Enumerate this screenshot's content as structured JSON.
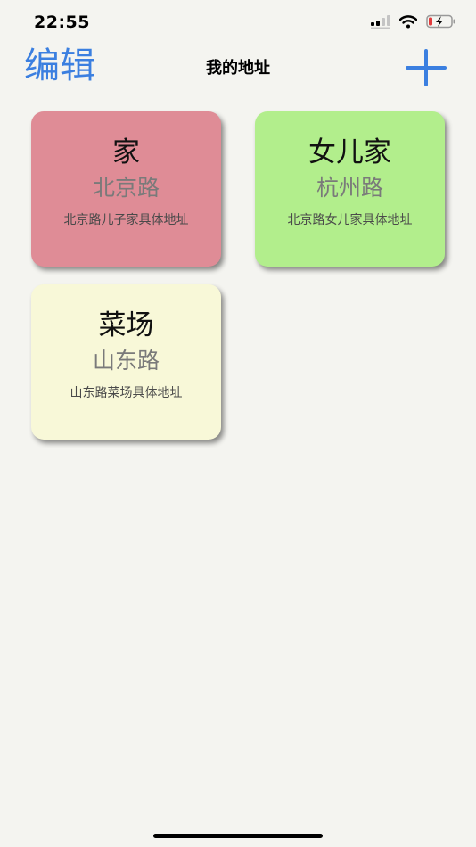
{
  "status_bar": {
    "time": "22:55",
    "icons": [
      "cellular-signal-icon",
      "wifi-icon",
      "battery-charging-icon"
    ],
    "battery_color": "#e23b3b"
  },
  "nav": {
    "edit_label": "编辑",
    "title": "我的地址",
    "add_icon": "plus-icon",
    "accent_color": "#3b7fe0"
  },
  "addresses": [
    {
      "name": "家",
      "road": "北京路",
      "detail": "北京路儿子家具体地址",
      "color": "#df8c96"
    },
    {
      "name": "女儿家",
      "road": "杭州路",
      "detail": "北京路女儿家具体地址",
      "color": "#b2ee8c"
    },
    {
      "name": "菜场",
      "road": "山东路",
      "detail": "山东路菜场具体地址",
      "color": "#f8f8d8"
    }
  ]
}
